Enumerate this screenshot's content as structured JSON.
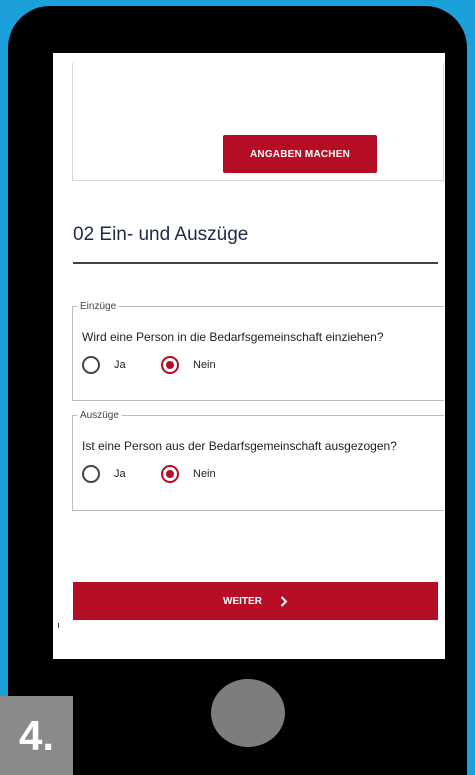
{
  "angaben_button": {
    "label": "ANGABEN MACHEN"
  },
  "section": {
    "title": "02 Ein- und Auszüge"
  },
  "einzuege": {
    "legend": "Einzüge",
    "question": "Wird eine Person in die Bedarfsgemeinschaft einziehen?",
    "option_ja": "Ja",
    "option_nein": "Nein",
    "selected": "Nein"
  },
  "auszuege": {
    "legend": "Auszüge",
    "question": "Ist eine Person aus der Bedarfsgemeinschaft ausgezogen?",
    "option_ja": "Ja",
    "option_nein": "Nein",
    "selected": "Nein"
  },
  "weiter_button": {
    "label": "WEITER",
    "icon": "chevron-right-icon"
  },
  "colors": {
    "accent": "#b50d23",
    "background": "#1ca0dc",
    "device": "#000000"
  },
  "step_badge": "4."
}
